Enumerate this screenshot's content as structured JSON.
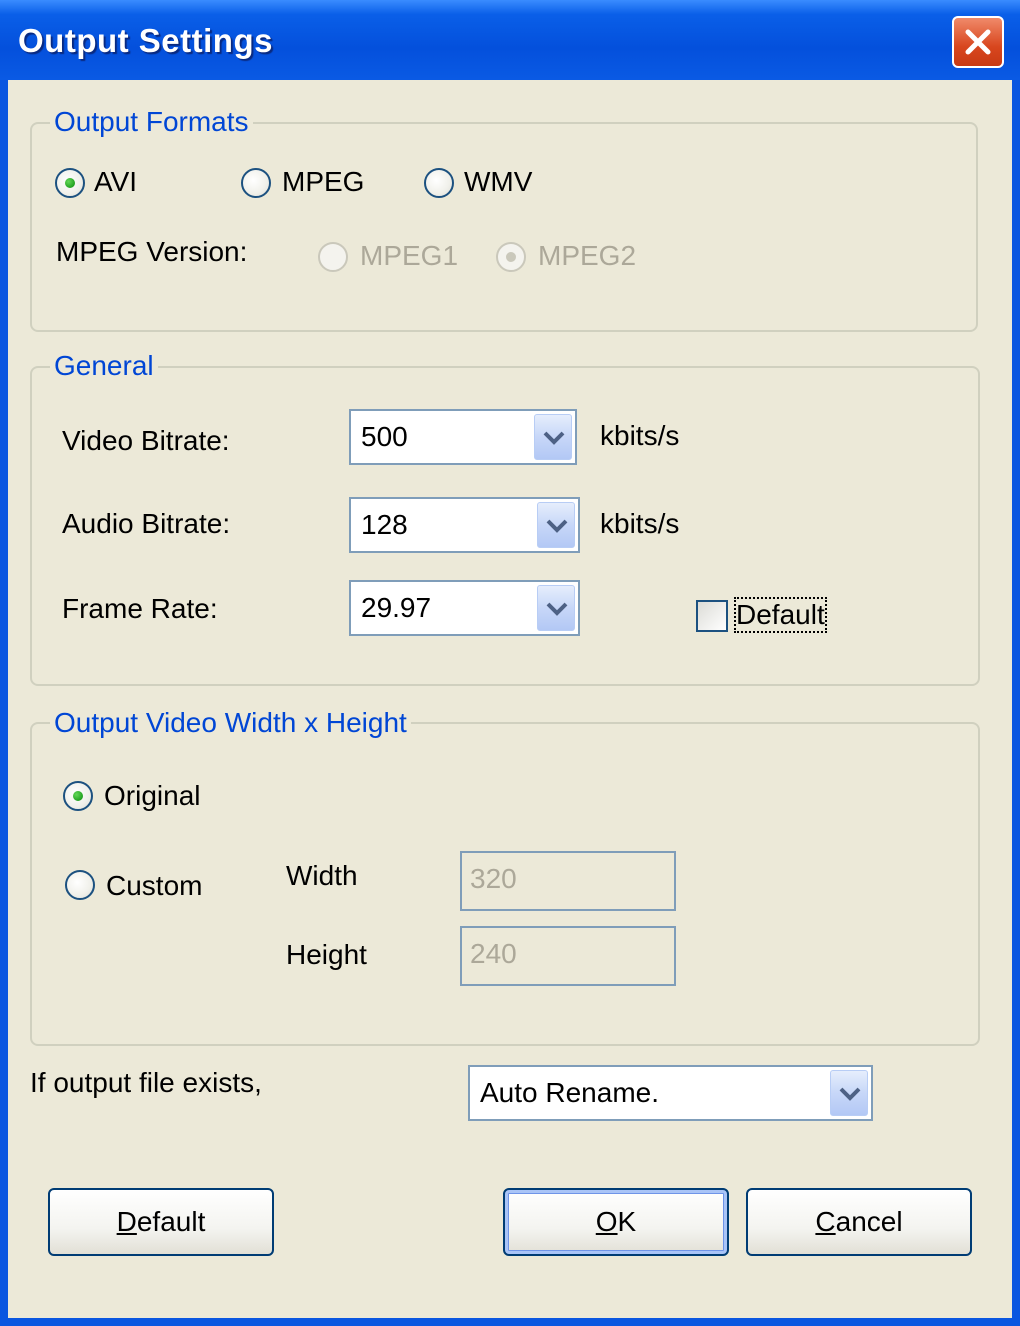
{
  "window": {
    "title": "Output Settings"
  },
  "output_formats": {
    "legend": "Output Formats",
    "options": [
      {
        "label": "AVI",
        "selected": true
      },
      {
        "label": "MPEG",
        "selected": false
      },
      {
        "label": "WMV",
        "selected": false
      }
    ],
    "mpeg_version_label": "MPEG Version:",
    "mpeg_versions": [
      {
        "label": "MPEG1",
        "selected": false,
        "enabled": false
      },
      {
        "label": "MPEG2",
        "selected": true,
        "enabled": false
      }
    ]
  },
  "general": {
    "legend": "General",
    "video_bitrate": {
      "label": "Video Bitrate:",
      "value": "500",
      "unit": "kbits/s"
    },
    "audio_bitrate": {
      "label": "Audio Bitrate:",
      "value": "128",
      "unit": "kbits/s"
    },
    "frame_rate": {
      "label": "Frame Rate:",
      "value": "29.97"
    },
    "default_checkbox": {
      "label": "Default",
      "checked": false
    }
  },
  "video_size": {
    "legend": "Output Video Width x Height",
    "original_label": "Original",
    "custom_label": "Custom",
    "selected": "Original",
    "width_label": "Width",
    "width_value": "320",
    "height_label": "Height",
    "height_value": "240"
  },
  "file_exists": {
    "label": "If output file exists,",
    "value": "Auto Rename."
  },
  "buttons": {
    "default": {
      "accel": "D",
      "rest": "efault"
    },
    "ok": {
      "accel": "O",
      "rest": "K"
    },
    "cancel": {
      "accel": "C",
      "rest": "ancel"
    }
  }
}
